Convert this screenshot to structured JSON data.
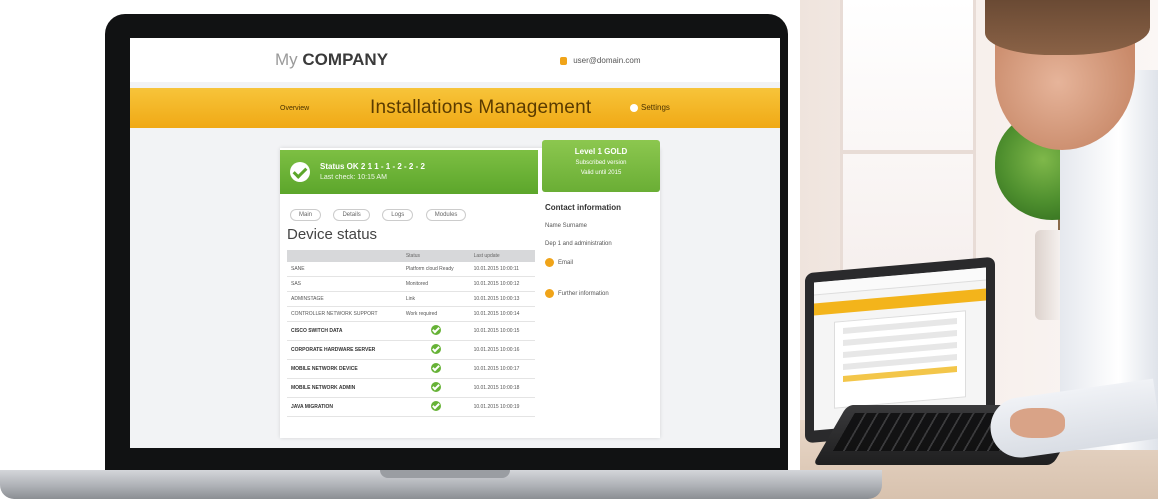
{
  "header": {
    "brand_my": "My",
    "brand_company": "COMPANY",
    "user": "user@domain.com"
  },
  "band": {
    "left": "Overview",
    "title": "Installations Management",
    "right": "Settings"
  },
  "status": {
    "line1": "Status OK 2 1 1 - 1 - 2 - 2 - 2",
    "line2": "Last check: 10:15 AM"
  },
  "side_card": {
    "title": "Level 1 GOLD",
    "line1": "Subscribed version",
    "line2": "Valid until 2015"
  },
  "tabs": [
    "Main",
    "Details",
    "Logs",
    "Modules"
  ],
  "section_title": "Device status",
  "table": {
    "headers": [
      "",
      "Status",
      "Last update"
    ],
    "rows": [
      {
        "name": "SANE",
        "status": "Platform cloud Ready",
        "time": "10.01.2015 10:00:11",
        "ok": false
      },
      {
        "name": "SAS",
        "status": "Monitored",
        "time": "10.01.2015 10:00:12",
        "ok": false
      },
      {
        "name": "ADMINSTAGE",
        "status": "Link",
        "time": "10.01.2015 10:00:13",
        "ok": false
      },
      {
        "name": "CONTROLLER NETWORK SUPPORT",
        "status": "Work required",
        "time": "10.01.2015 10:00:14",
        "ok": false
      },
      {
        "name": "CISCO SWITCH DATA",
        "status": "",
        "time": "10.01.2015 10:00:15",
        "ok": true
      },
      {
        "name": "CORPORATE HARDWARE SERVER",
        "status": "",
        "time": "10.01.2015 10:00:16",
        "ok": true
      },
      {
        "name": "MOBILE NETWORK DEVICE",
        "status": "",
        "time": "10.01.2015 10:00:17",
        "ok": true
      },
      {
        "name": "MOBILE NETWORK ADMIN",
        "status": "",
        "time": "10.01.2015 10:00:18",
        "ok": true
      },
      {
        "name": "JAVA MIGRATION",
        "status": "",
        "time": "10.01.2015 10:00:19",
        "ok": true
      }
    ]
  },
  "contact": {
    "title": "Contact information",
    "name": "Name Surname",
    "company": "Dep 1 and administration",
    "email_label": "Email",
    "help_label": "Further information"
  },
  "colors": {
    "accent_yellow": "#f0a915",
    "ok_green": "#66b236"
  }
}
